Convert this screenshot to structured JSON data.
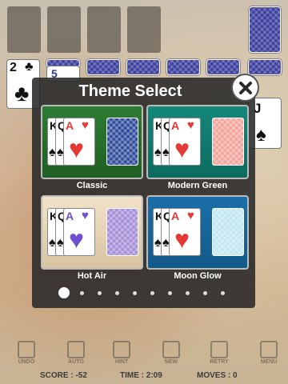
{
  "dialog": {
    "title": "Theme Select",
    "themes": [
      {
        "label": "Classic",
        "bg": "#2e7d32",
        "back_color": "#2d4a9a",
        "suit_color": "#e53935",
        "accent": "#1f5f23"
      },
      {
        "label": "Modern Green",
        "bg": "#14897b",
        "back_color": "#f2a39a",
        "suit_color": "#e53935",
        "accent": "#0b6b60"
      },
      {
        "label": "Hot Air",
        "bg": "#f2e2c8",
        "back_color": "#a58cd6",
        "suit_color": "#6e4fd1",
        "accent": "#d9c4a0"
      },
      {
        "label": "Moon Glow",
        "bg": "#1b6fa8",
        "back_color": "#bfe6f2",
        "suit_color": "#e53935",
        "accent": "#125a8a"
      }
    ],
    "page_indicator": {
      "pages": 10,
      "current": 1
    }
  },
  "board": {
    "visible_card_rank": "2",
    "visible_card_suit": "♣",
    "second_rank": "5",
    "right_card_rank": "J",
    "right_card_suit": "♠"
  },
  "toolbar": [
    {
      "label": "UNDO",
      "icon": "undo-icon"
    },
    {
      "label": "AUTO",
      "icon": "auto-icon"
    },
    {
      "label": "HINT",
      "icon": "hint-icon"
    },
    {
      "label": "NEW",
      "icon": "new-icon"
    },
    {
      "label": "RETRY",
      "icon": "retry-icon"
    },
    {
      "label": "MENU",
      "icon": "menu-icon"
    }
  ],
  "status": {
    "score": "SCORE : -52",
    "time": "TIME : 2:09",
    "moves": "MOVES : 0"
  }
}
